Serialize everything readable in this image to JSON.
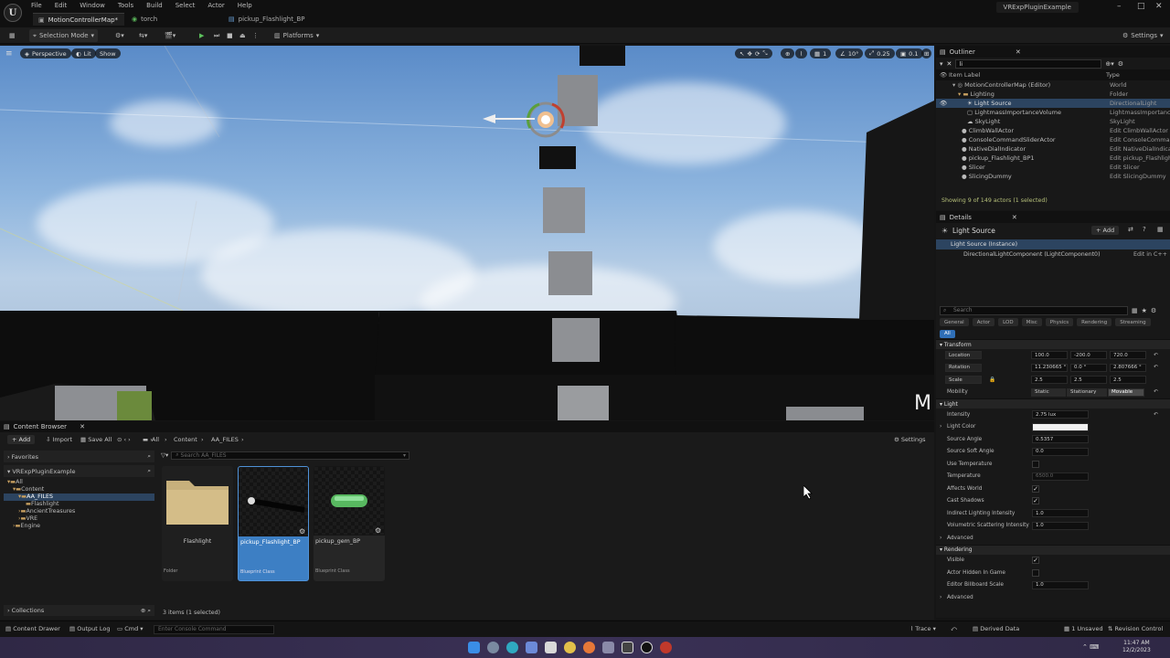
{
  "menubar": {
    "items": [
      "File",
      "Edit",
      "Window",
      "Tools",
      "Build",
      "Select",
      "Actor",
      "Help"
    ],
    "tabs": [
      "MotionControllerMap*",
      "torch",
      "pickup_Flashlight_BP"
    ],
    "project": "VRExpPluginExample"
  },
  "toolbar": {
    "selection_mode": "Selection Mode",
    "platforms": "Platforms",
    "settings": "Settings"
  },
  "viewport": {
    "perspective": "Perspective",
    "lit": "Lit",
    "show": "Show",
    "fov": "10°",
    "speed": "0.25",
    "cam": "0.1",
    "grid": "1"
  },
  "outliner": {
    "title": "Outliner",
    "search_value": "li",
    "col_label": "Item Label",
    "col_type": "Type",
    "rows": [
      {
        "label": "MotionControllerMap (Editor)",
        "type": "World"
      },
      {
        "label": "Lighting",
        "type": "Folder"
      },
      {
        "label": "Light Source",
        "type": "DirectionalLight"
      },
      {
        "label": "LightmassImportanceVolume",
        "type": "LightmassImportance"
      },
      {
        "label": "SkyLight",
        "type": "SkyLight"
      },
      {
        "label": "ClimbWallActor",
        "type": "Edit ClimbWallActor"
      },
      {
        "label": "ConsoleCommandSliderActor",
        "type": "Edit ConsoleComman"
      },
      {
        "label": "NativeDialIndicator",
        "type": "Edit NativeDialIndicat"
      },
      {
        "label": "pickup_Flashlight_BP1",
        "type": "Edit pickup_Flashlight"
      },
      {
        "label": "Slicer",
        "type": "Edit Slicer"
      },
      {
        "label": "SlicingDummy",
        "type": "Edit SlicingDummy"
      }
    ],
    "status": "Showing 9 of 149 actors (1 selected)"
  },
  "details": {
    "title": "Details",
    "actor": "Light Source",
    "add": "+ Add",
    "instance": "Light Source (Instance)",
    "component": "DirectionalLightComponent (LightComponent0)",
    "edit_cpp": "Edit in C++",
    "search_placeholder": "Search",
    "filters": [
      "General",
      "Actor",
      "LOD",
      "Misc",
      "Physics",
      "Rendering",
      "Streaming"
    ],
    "filter_all": "All",
    "transform": "Transform",
    "location": "Location",
    "rotation": "Rotation",
    "scale": "Scale",
    "loc": [
      "100.0",
      "-200.0",
      "720.0"
    ],
    "rot": [
      "11.230665 °",
      "0.0 °",
      "2.807666 °"
    ],
    "scl": [
      "2.5",
      "2.5",
      "2.5"
    ],
    "mobility": "Mobility",
    "mob_opts": [
      "Static",
      "Stationary",
      "Movable"
    ],
    "light": "Light",
    "intensity_l": "Intensity",
    "intensity": "2.75 lux",
    "light_color": "Light Color",
    "source_angle_l": "Source Angle",
    "source_angle": "0.5357",
    "source_soft_l": "Source Soft Angle",
    "source_soft": "0.0",
    "use_temp": "Use Temperature",
    "temp_l": "Temperature",
    "temp": "6500.0",
    "affects_world": "Affects World",
    "cast_shadows": "Cast Shadows",
    "indirect_l": "Indirect Lighting Intensity",
    "indirect": "1.0",
    "vol_l": "Volumetric Scattering Intensity",
    "vol": "1.0",
    "advanced": "Advanced",
    "rendering": "Rendering",
    "visible": "Visible",
    "hidden_game": "Actor Hidden In Game",
    "billboard_l": "Editor Billboard Scale",
    "billboard": "1.0",
    "advanced2": "Advanced"
  },
  "content_browser": {
    "title": "Content Browser",
    "add": "+ Add",
    "import": "Import",
    "save_all": "Save All",
    "path": [
      "All",
      "Content",
      "AA_FILES"
    ],
    "settings": "Settings",
    "favorites": "Favorites",
    "project": "VRExpPluginExample",
    "search_placeholder": "Search AA_FILES",
    "tree": [
      "All",
      "Content",
      "AA_FILES",
      "Flashlight",
      "AncientTreasures",
      "VRE",
      "Engine"
    ],
    "collections": "Collections",
    "assets": [
      {
        "name": "Flashlight",
        "type": "Folder"
      },
      {
        "name": "pickup_Flashlight_BP",
        "type": "Blueprint Class"
      },
      {
        "name": "pickup_gem_BP",
        "type": "Blueprint Class"
      }
    ],
    "item_count": "3 items (1 selected)"
  },
  "statusbar": {
    "content_drawer": "Content Drawer",
    "output_log": "Output Log",
    "cmd": "Cmd",
    "console_placeholder": "Enter Console Command",
    "trace": "Trace",
    "derived_data": "Derived Data",
    "unsaved": "1 Unsaved",
    "revision": "Revision Control"
  },
  "taskbar": {
    "time": "11:47 AM",
    "date": "12/2/2023"
  },
  "colors": {
    "accent": "#2c4460",
    "selected_asset": "#3d7fc4",
    "sky": "#8fb6df"
  }
}
